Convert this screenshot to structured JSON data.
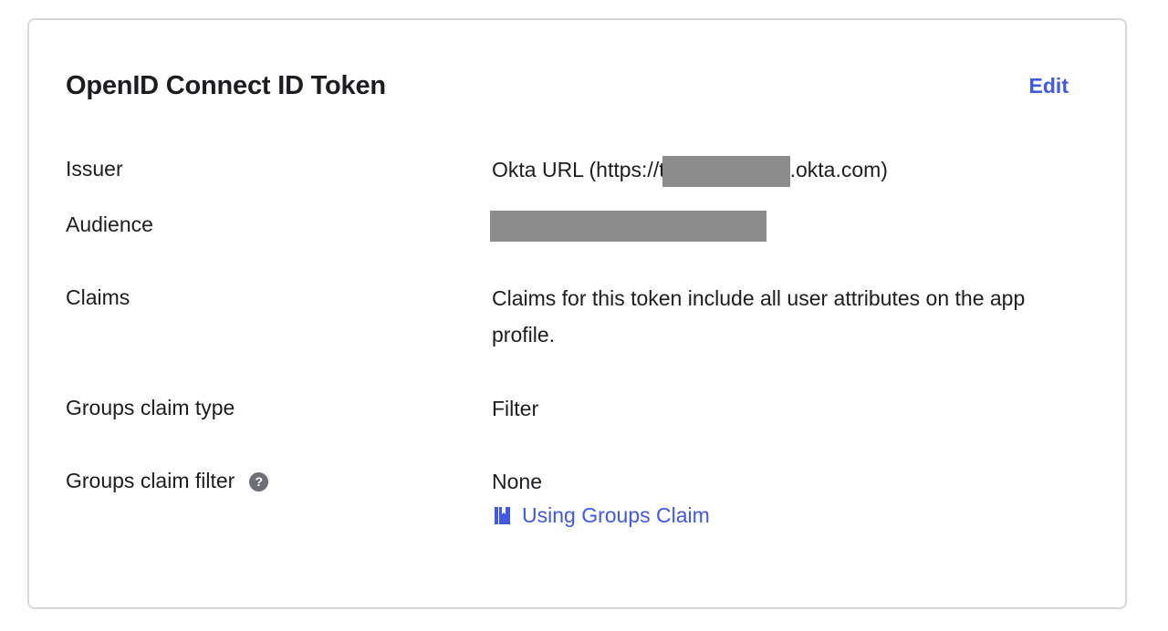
{
  "card": {
    "title": "OpenID Connect ID Token",
    "edit_label": "Edit"
  },
  "rows": {
    "issuer": {
      "label": "Issuer",
      "value_prefix": "Okta URL (https://t",
      "value_suffix": ".okta.com)"
    },
    "audience": {
      "label": "Audience"
    },
    "claims": {
      "label": "Claims",
      "value": "Claims for this token include all user attributes on the app profile."
    },
    "groups_claim_type": {
      "label": "Groups claim type",
      "value": "Filter"
    },
    "groups_claim_filter": {
      "label": "Groups claim filter",
      "help_icon": "?",
      "value": "None",
      "link_icon": "book-icon",
      "link_label": "Using Groups Claim"
    }
  },
  "colors": {
    "accent": "#3f59e4",
    "text": "#1d1d21",
    "border": "#d7d7dc",
    "redaction": "#8c8c8c",
    "help_icon": "#6e6e78"
  }
}
